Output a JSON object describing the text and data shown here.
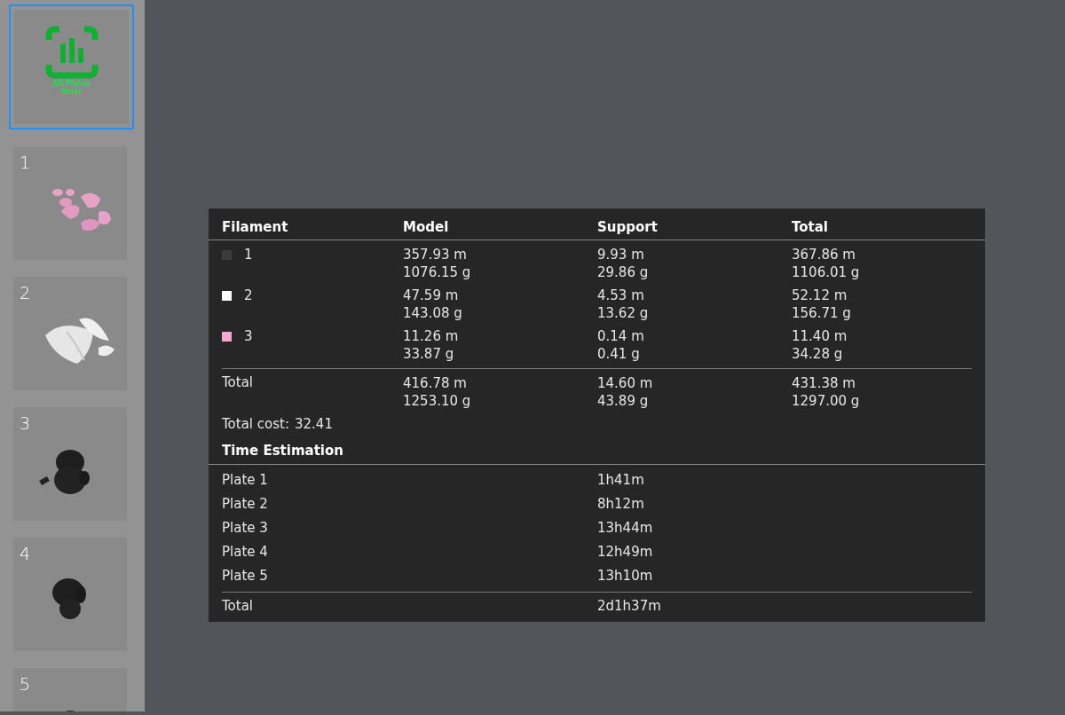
{
  "plates": [
    {
      "kind": "stats",
      "label": "All Plates Stats",
      "selected": true
    },
    {
      "kind": "plate",
      "number": "1",
      "selected": false
    },
    {
      "kind": "plate",
      "number": "2",
      "selected": false
    },
    {
      "kind": "plate",
      "number": "3",
      "selected": false
    },
    {
      "kind": "plate",
      "number": "4",
      "selected": false
    },
    {
      "kind": "plate",
      "number": "5",
      "selected": false
    }
  ],
  "filament_table": {
    "columns": [
      "Filament",
      "Model",
      "Support",
      "Total"
    ],
    "rows": [
      {
        "filament": "1",
        "color": "#3c3c3c",
        "model": [
          "357.93 m",
          "1076.15 g"
        ],
        "support": [
          "9.93 m",
          "29.86 g"
        ],
        "total": [
          "367.86 m",
          "1106.01 g"
        ]
      },
      {
        "filament": "2",
        "color": "#ffffff",
        "model": [
          "47.59 m",
          "143.08 g"
        ],
        "support": [
          "4.53 m",
          "13.62 g"
        ],
        "total": [
          "52.12 m",
          "156.71 g"
        ]
      },
      {
        "filament": "3",
        "color": "#f4a7cf",
        "model": [
          "11.26 m",
          "33.87 g"
        ],
        "support": [
          "0.14 m",
          "0.41 g"
        ],
        "total": [
          "11.40 m",
          "34.28 g"
        ]
      }
    ],
    "total_row": {
      "label": "Total",
      "model": [
        "416.78 m",
        "1253.10 g"
      ],
      "support": [
        "14.60 m",
        "43.89 g"
      ],
      "total": [
        "431.38 m",
        "1297.00 g"
      ]
    }
  },
  "total_cost": {
    "label": "Total cost:",
    "value": "32.41"
  },
  "time_estimation": {
    "title": "Time Estimation",
    "rows": [
      {
        "label": "Plate 1",
        "time": "1h41m"
      },
      {
        "label": "Plate 2",
        "time": "8h12m"
      },
      {
        "label": "Plate 3",
        "time": "13h44m"
      },
      {
        "label": "Plate 4",
        "time": "12h49m"
      },
      {
        "label": "Plate 5",
        "time": "13h10m"
      }
    ],
    "total": {
      "label": "Total",
      "time": "2d1h37m"
    }
  }
}
